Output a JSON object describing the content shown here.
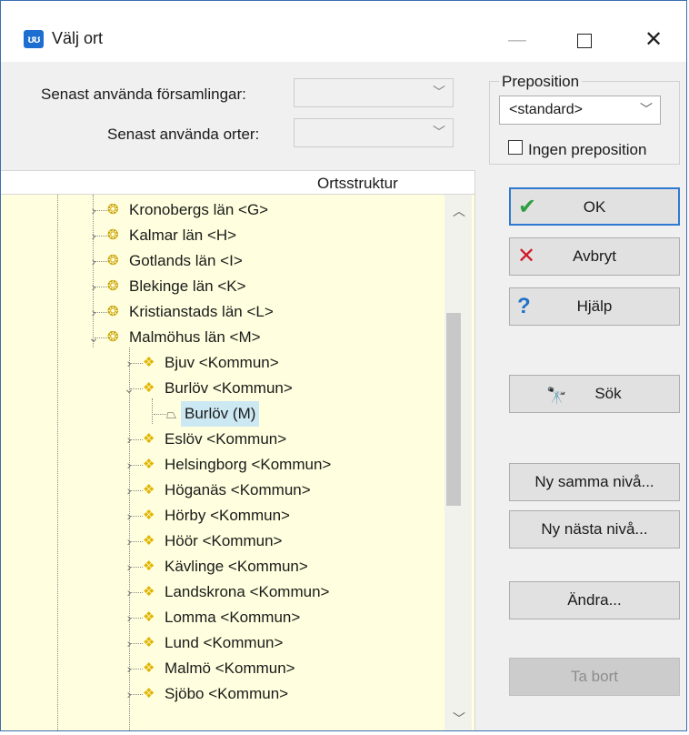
{
  "window": {
    "title": "Välj ort",
    "app_icon": "app-icon-blue"
  },
  "filters": {
    "recent_parishes_label": "Senast använda församlingar:",
    "recent_places_label": "Senast använda orter:"
  },
  "preposition": {
    "group_label": "Preposition",
    "selected": "<standard>",
    "no_preposition_label": "Ingen preposition"
  },
  "tree": {
    "header": "Ortsstruktur",
    "items": [
      {
        "label": "Kronobergs län <G>",
        "level": 0,
        "expanded": false,
        "icon": "county-icon"
      },
      {
        "label": "Kalmar län <H>",
        "level": 0,
        "expanded": false,
        "icon": "county-icon"
      },
      {
        "label": "Gotlands län <I>",
        "level": 0,
        "expanded": false,
        "icon": "county-icon"
      },
      {
        "label": "Blekinge län <K>",
        "level": 0,
        "expanded": false,
        "icon": "county-icon"
      },
      {
        "label": "Kristianstads län <L>",
        "level": 0,
        "expanded": false,
        "icon": "county-icon"
      },
      {
        "label": "Malmöhus län <M>",
        "level": 0,
        "expanded": true,
        "icon": "county-icon"
      },
      {
        "label": "Bjuv <Kommun>",
        "level": 1,
        "expanded": false,
        "icon": "municipality-icon"
      },
      {
        "label": "Burlöv <Kommun>",
        "level": 1,
        "expanded": true,
        "icon": "municipality-icon"
      },
      {
        "label": "Burlöv (M)",
        "level": 2,
        "selected": true,
        "icon": "place-icon"
      },
      {
        "label": "Eslöv <Kommun>",
        "level": 1,
        "expanded": false,
        "icon": "municipality-icon"
      },
      {
        "label": "Helsingborg <Kommun>",
        "level": 1,
        "expanded": false,
        "icon": "municipality-icon"
      },
      {
        "label": "Höganäs <Kommun>",
        "level": 1,
        "expanded": false,
        "icon": "municipality-icon"
      },
      {
        "label": "Hörby <Kommun>",
        "level": 1,
        "expanded": false,
        "icon": "municipality-icon"
      },
      {
        "label": "Höör <Kommun>",
        "level": 1,
        "expanded": false,
        "icon": "municipality-icon"
      },
      {
        "label": "Kävlinge <Kommun>",
        "level": 1,
        "expanded": false,
        "icon": "municipality-icon"
      },
      {
        "label": "Landskrona <Kommun>",
        "level": 1,
        "expanded": false,
        "icon": "municipality-icon"
      },
      {
        "label": "Lomma <Kommun>",
        "level": 1,
        "expanded": false,
        "icon": "municipality-icon"
      },
      {
        "label": "Lund <Kommun>",
        "level": 1,
        "expanded": false,
        "icon": "municipality-icon"
      },
      {
        "label": "Malmö <Kommun>",
        "level": 1,
        "expanded": false,
        "icon": "municipality-icon"
      },
      {
        "label": "Sjöbo <Kommun>",
        "level": 1,
        "expanded": false,
        "icon": "municipality-icon"
      }
    ]
  },
  "buttons": {
    "ok": "OK",
    "cancel": "Avbryt",
    "help": "Hjälp",
    "find": "Sök",
    "new_same_level": "Ny samma nivå...",
    "new_next_level": "Ny nästa nivå...",
    "edit": "Ändra...",
    "delete": "Ta bort"
  },
  "colors": {
    "tree_background": "#ffffdf",
    "accent": "#2f7ad0",
    "ok_check": "#2ea043",
    "cancel_x": "#d11a2a",
    "selection": "#cce8f2"
  }
}
